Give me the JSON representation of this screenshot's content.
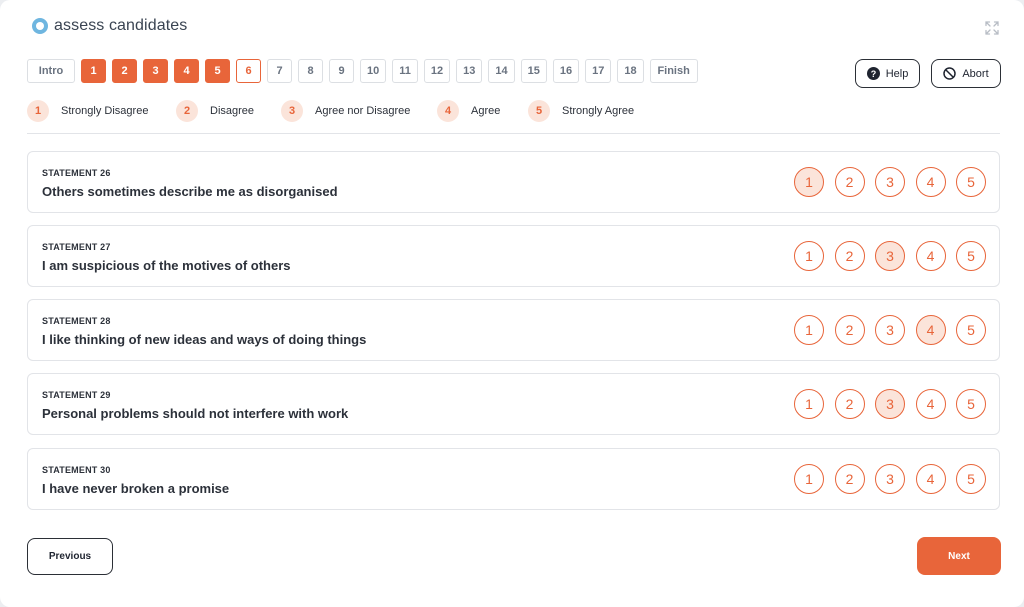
{
  "app": {
    "name": "assess candidates"
  },
  "stepper": {
    "steps": [
      {
        "label": "Intro",
        "state": "plain"
      },
      {
        "label": "1",
        "state": "done"
      },
      {
        "label": "2",
        "state": "done"
      },
      {
        "label": "3",
        "state": "done"
      },
      {
        "label": "4",
        "state": "done"
      },
      {
        "label": "5",
        "state": "done"
      },
      {
        "label": "6",
        "state": "current"
      },
      {
        "label": "7",
        "state": "plain"
      },
      {
        "label": "8",
        "state": "plain"
      },
      {
        "label": "9",
        "state": "plain"
      },
      {
        "label": "10",
        "state": "plain"
      },
      {
        "label": "11",
        "state": "plain"
      },
      {
        "label": "12",
        "state": "plain"
      },
      {
        "label": "13",
        "state": "plain"
      },
      {
        "label": "14",
        "state": "plain"
      },
      {
        "label": "15",
        "state": "plain"
      },
      {
        "label": "16",
        "state": "plain"
      },
      {
        "label": "17",
        "state": "plain"
      },
      {
        "label": "18",
        "state": "plain"
      },
      {
        "label": "Finish",
        "state": "plain"
      }
    ]
  },
  "actions": {
    "help_label": "Help",
    "abort_label": "Abort"
  },
  "legend": [
    {
      "num": "1",
      "label": "Strongly Disagree"
    },
    {
      "num": "2",
      "label": "Disagree"
    },
    {
      "num": "3",
      "label": "Agree nor Disagree"
    },
    {
      "num": "4",
      "label": "Agree"
    },
    {
      "num": "5",
      "label": "Strongly Agree"
    }
  ],
  "statements": [
    {
      "number": "STATEMENT 26",
      "text": "Others sometimes describe me as disorganised",
      "selected": 1
    },
    {
      "number": "STATEMENT 27",
      "text": "I am suspicious of the motives of others",
      "selected": 3
    },
    {
      "number": "STATEMENT 28",
      "text": "I like thinking of new ideas and ways of doing things",
      "selected": 4
    },
    {
      "number": "STATEMENT 29",
      "text": "Personal problems should not interfere with work",
      "selected": 3
    },
    {
      "number": "STATEMENT 30",
      "text": "I have never broken a promise",
      "selected": 0
    }
  ],
  "option_labels": [
    "1",
    "2",
    "3",
    "4",
    "5"
  ],
  "nav": {
    "previous_label": "Previous",
    "next_label": "Next"
  },
  "colors": {
    "accent": "#e8653a",
    "accent_light": "#fbe4da",
    "logo": "#6fb6e0"
  },
  "icons": {
    "logo": "logo-ring-icon",
    "expand": "expand-icon",
    "help": "question-icon",
    "abort": "no-entry-icon"
  }
}
